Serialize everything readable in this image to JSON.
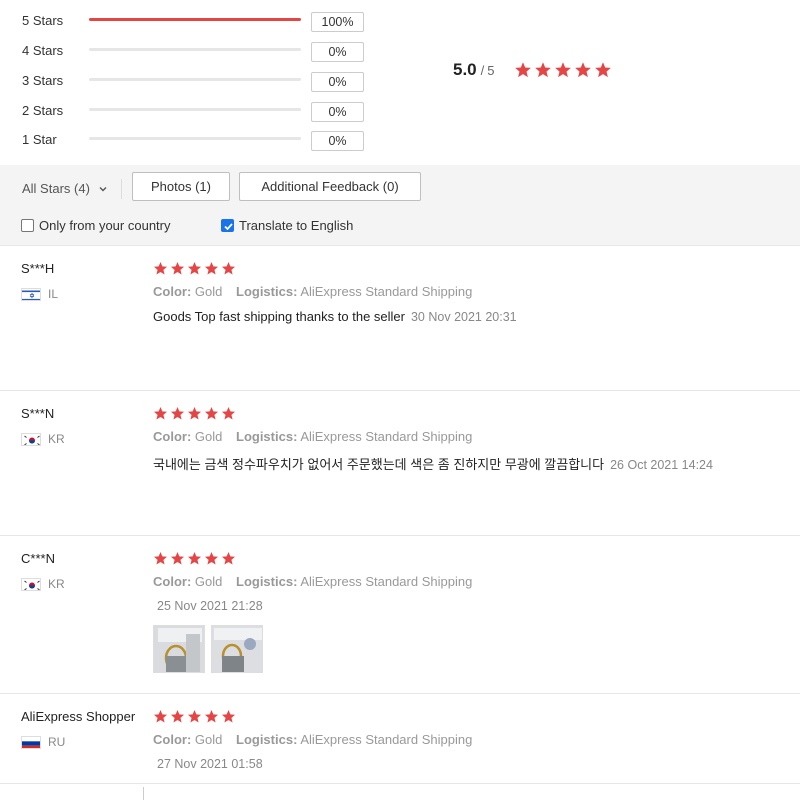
{
  "rating_summary": {
    "rows": [
      {
        "label": "5 Stars",
        "percent_text": "100%",
        "fill": 1.0
      },
      {
        "label": "4 Stars",
        "percent_text": "0%",
        "fill": 0.0
      },
      {
        "label": "3 Stars",
        "percent_text": "0%",
        "fill": 0.0
      },
      {
        "label": "2 Stars",
        "percent_text": "0%",
        "fill": 0.0
      },
      {
        "label": "1 Star",
        "percent_text": "0%",
        "fill": 0.0
      }
    ],
    "average": "5.0",
    "separator": "/",
    "max": "5",
    "star_count": 5
  },
  "filters": {
    "all_stars": "All Stars (4)",
    "photos": "Photos (1)",
    "additional_feedback": "Additional Feedback (0)",
    "only_country": {
      "label": "Only from your country",
      "checked": false
    },
    "translate": {
      "label": "Translate to English",
      "checked": true
    }
  },
  "reviews": [
    {
      "name": "S***H",
      "country": "IL",
      "stars": 5,
      "color_label": "Color:",
      "color_value": "Gold",
      "logistics_label": "Logistics:",
      "logistics_value": "AliExpress Standard Shipping",
      "text": "Goods Top fast shipping thanks to the seller",
      "date": "30 Nov 2021 20:31"
    },
    {
      "name": "S***N",
      "country": "KR",
      "stars": 5,
      "color_label": "Color:",
      "color_value": "Gold",
      "logistics_label": "Logistics:",
      "logistics_value": "AliExpress Standard Shipping",
      "text": "국내에는 금색 정수파우치가 없어서 주문했는데 색은 좀 진하지만 무광에 깔끔합니다",
      "date": "26 Oct 2021 14:24"
    },
    {
      "name": "C***N",
      "country": "KR",
      "stars": 5,
      "color_label": "Color:",
      "color_value": "Gold",
      "logistics_label": "Logistics:",
      "logistics_value": "AliExpress Standard Shipping",
      "text": "",
      "date": "25 Nov 2021 21:28",
      "photo_count": 2
    },
    {
      "name": "AliExpress Shopper",
      "country": "RU",
      "stars": 5,
      "color_label": "Color:",
      "color_value": "Gold",
      "logistics_label": "Logistics:",
      "logistics_value": "AliExpress Standard Shipping",
      "text": "",
      "date": "27 Nov 2021 01:58"
    }
  ],
  "colors": {
    "accent_red": "#e64545",
    "checkbox_blue": "#1a73e8",
    "filter_bg": "#f4f4f4"
  },
  "icons": [
    "star-icon",
    "chevron-down-icon",
    "check-icon",
    "flag-il-icon",
    "flag-kr-icon",
    "flag-ru-icon"
  ]
}
